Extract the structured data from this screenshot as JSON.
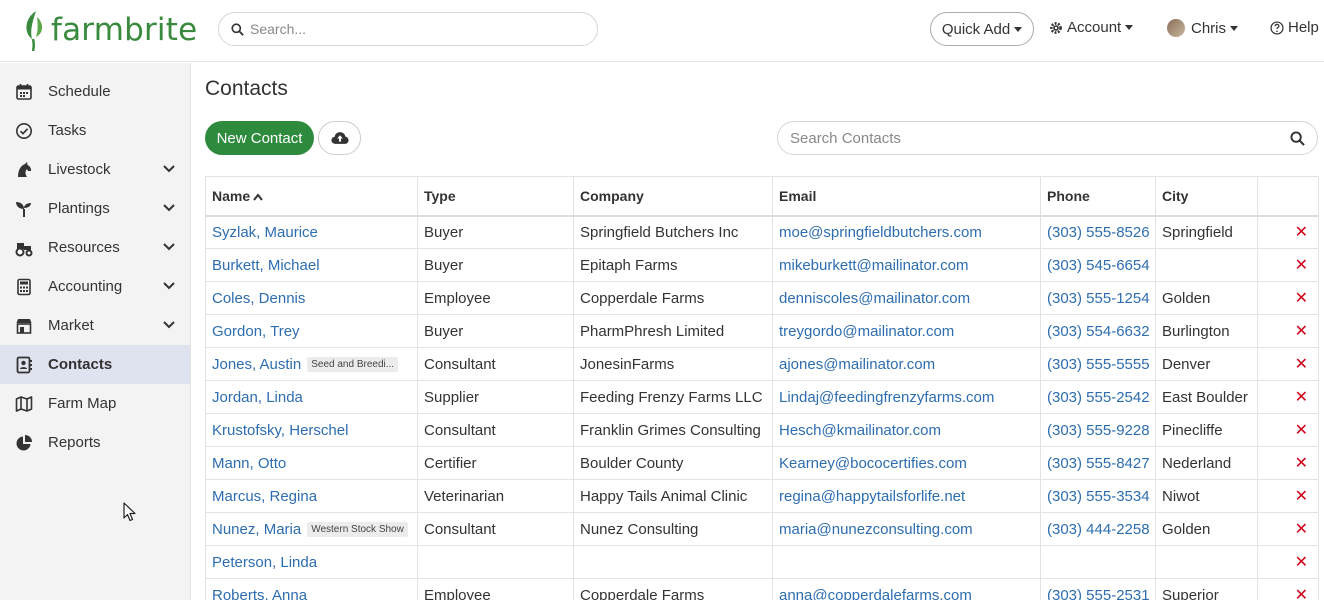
{
  "header": {
    "brand": "farmbrite",
    "search_placeholder": "Search...",
    "quick_add": "Quick Add",
    "account": "Account",
    "user": "Chris",
    "help": "Help"
  },
  "sidebar": {
    "items": [
      {
        "label": "Schedule",
        "icon": "calendar-icon"
      },
      {
        "label": "Tasks",
        "icon": "check-circle-icon"
      },
      {
        "label": "Livestock",
        "icon": "horse-head-icon"
      },
      {
        "label": "Plantings",
        "icon": "seedling-icon"
      },
      {
        "label": "Resources",
        "icon": "tractor-icon"
      },
      {
        "label": "Accounting",
        "icon": "calculator-icon"
      },
      {
        "label": "Market",
        "icon": "store-icon"
      },
      {
        "label": "Contacts",
        "icon": "address-book-icon"
      },
      {
        "label": "Farm Map",
        "icon": "map-icon"
      },
      {
        "label": "Reports",
        "icon": "pie-chart-icon"
      }
    ]
  },
  "main": {
    "title": "Contacts",
    "new_contact_label": "New Contact",
    "search_placeholder": "Search Contacts",
    "columns": [
      "Name",
      "Type",
      "Company",
      "Email",
      "Phone",
      "City"
    ],
    "rows": [
      {
        "name": "Syzlak, Maurice",
        "tag": "",
        "type": "Buyer",
        "company": "Springfield Butchers Inc",
        "email": "moe@springfieldbutchers.com",
        "phone": "(303) 555-8526",
        "city": "Springfield"
      },
      {
        "name": "Burkett, Michael",
        "tag": "",
        "type": "Buyer",
        "company": "Epitaph Farms",
        "email": "mikeburkett@mailinator.com",
        "phone": "(303) 545-6654",
        "city": ""
      },
      {
        "name": "Coles, Dennis",
        "tag": "",
        "type": "Employee",
        "company": "Copperdale Farms",
        "email": "denniscoles@mailinator.com",
        "phone": "(303) 555-1254",
        "city": "Golden"
      },
      {
        "name": "Gordon, Trey",
        "tag": "",
        "type": "Buyer",
        "company": "PharmPhresh Limited",
        "email": "treygordo@mailinator.com",
        "phone": "(303) 554-6632",
        "city": "Burlington"
      },
      {
        "name": "Jones, Austin",
        "tag": "Seed and Breedi...",
        "type": "Consultant",
        "company": "JonesinFarms",
        "email": "ajones@mailinator.com",
        "phone": "(303) 555-5555",
        "city": "Denver"
      },
      {
        "name": "Jordan, Linda",
        "tag": "",
        "type": "Supplier",
        "company": "Feeding Frenzy Farms LLC",
        "email": "Lindaj@feedingfrenzyfarms.com",
        "phone": "(303) 555-2542",
        "city": "East Boulder"
      },
      {
        "name": "Krustofsky, Herschel",
        "tag": "",
        "type": "Consultant",
        "company": "Franklin Grimes Consulting",
        "email": "Hesch@kmailinator.com",
        "phone": "(303) 555-9228",
        "city": "Pinecliffe"
      },
      {
        "name": "Mann, Otto",
        "tag": "",
        "type": "Certifier",
        "company": "Boulder County",
        "email": "Kearney@bococertifies.com",
        "phone": "(303) 555-8427",
        "city": "Nederland"
      },
      {
        "name": "Marcus, Regina",
        "tag": "",
        "type": "Veterinarian",
        "company": "Happy Tails Animal Clinic",
        "email": "regina@happytailsforlife.net",
        "phone": "(303) 555-3534",
        "city": "Niwot"
      },
      {
        "name": "Nunez, Maria",
        "tag": "Western Stock Show",
        "type": "Consultant",
        "company": "Nunez Consulting",
        "email": "maria@nunezconsulting.com",
        "phone": "(303) 444-2258",
        "city": "Golden"
      },
      {
        "name": "Peterson, Linda",
        "tag": "",
        "type": "",
        "company": "",
        "email": "",
        "phone": "",
        "city": ""
      },
      {
        "name": "Roberts, Anna",
        "tag": "",
        "type": "Employee",
        "company": "Copperdale Farms",
        "email": "anna@copperdalefarms.com",
        "phone": "(303) 555-2531",
        "city": "Superior"
      }
    ],
    "delete_glyph": "✕"
  },
  "colors": {
    "brand_green": "#3a8a3e",
    "button_green": "#2e8b3e",
    "link_blue": "#2d6db0",
    "delete_red": "#d0021b",
    "sidebar_active": "#dfe3ef"
  }
}
